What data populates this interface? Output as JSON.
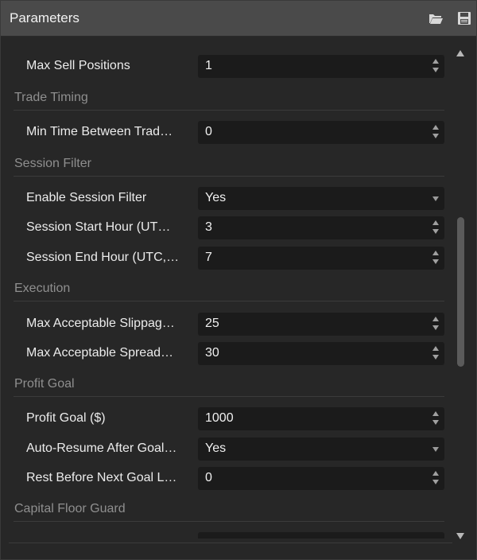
{
  "window": {
    "title": "Parameters"
  },
  "toolbar": {
    "open_icon": "folder-open-icon",
    "save_icon": "floppy-save-icon"
  },
  "rows": {
    "max_sell": {
      "label": "Max Sell Positions",
      "value": "1",
      "control": "spinner"
    },
    "min_time": {
      "label": "Min Time Between Trad…",
      "value": "0",
      "control": "spinner"
    },
    "enable_session": {
      "label": "Enable Session Filter",
      "value": "Yes",
      "control": "dropdown"
    },
    "session_start": {
      "label": "Session Start Hour (UT…",
      "value": "3",
      "control": "spinner"
    },
    "session_end": {
      "label": "Session End Hour (UTC,…",
      "value": "7",
      "control": "spinner"
    },
    "max_slippage": {
      "label": "Max Acceptable Slippag…",
      "value": "25",
      "control": "spinner"
    },
    "max_spread": {
      "label": "Max Acceptable Spread…",
      "value": "30",
      "control": "spinner"
    },
    "profit_goal": {
      "label": "Profit Goal ($)",
      "value": "1000",
      "control": "spinner"
    },
    "auto_resume": {
      "label": "Auto-Resume After Goal…",
      "value": "Yes",
      "control": "dropdown"
    },
    "rest_before": {
      "label": "Rest Before Next Goal L…",
      "value": "0",
      "control": "spinner"
    }
  },
  "sections": {
    "trade_timing": "Trade Timing",
    "session_filter": "Session Filter",
    "execution": "Execution",
    "profit_goal": "Profit Goal",
    "capital_floor": "Capital Floor Guard"
  },
  "colors": {
    "titlebar": "#4a4a4a",
    "panel": "#272727",
    "field": "#1b1b1b",
    "section_text": "#8f8f8f",
    "label_text": "#ececec"
  }
}
